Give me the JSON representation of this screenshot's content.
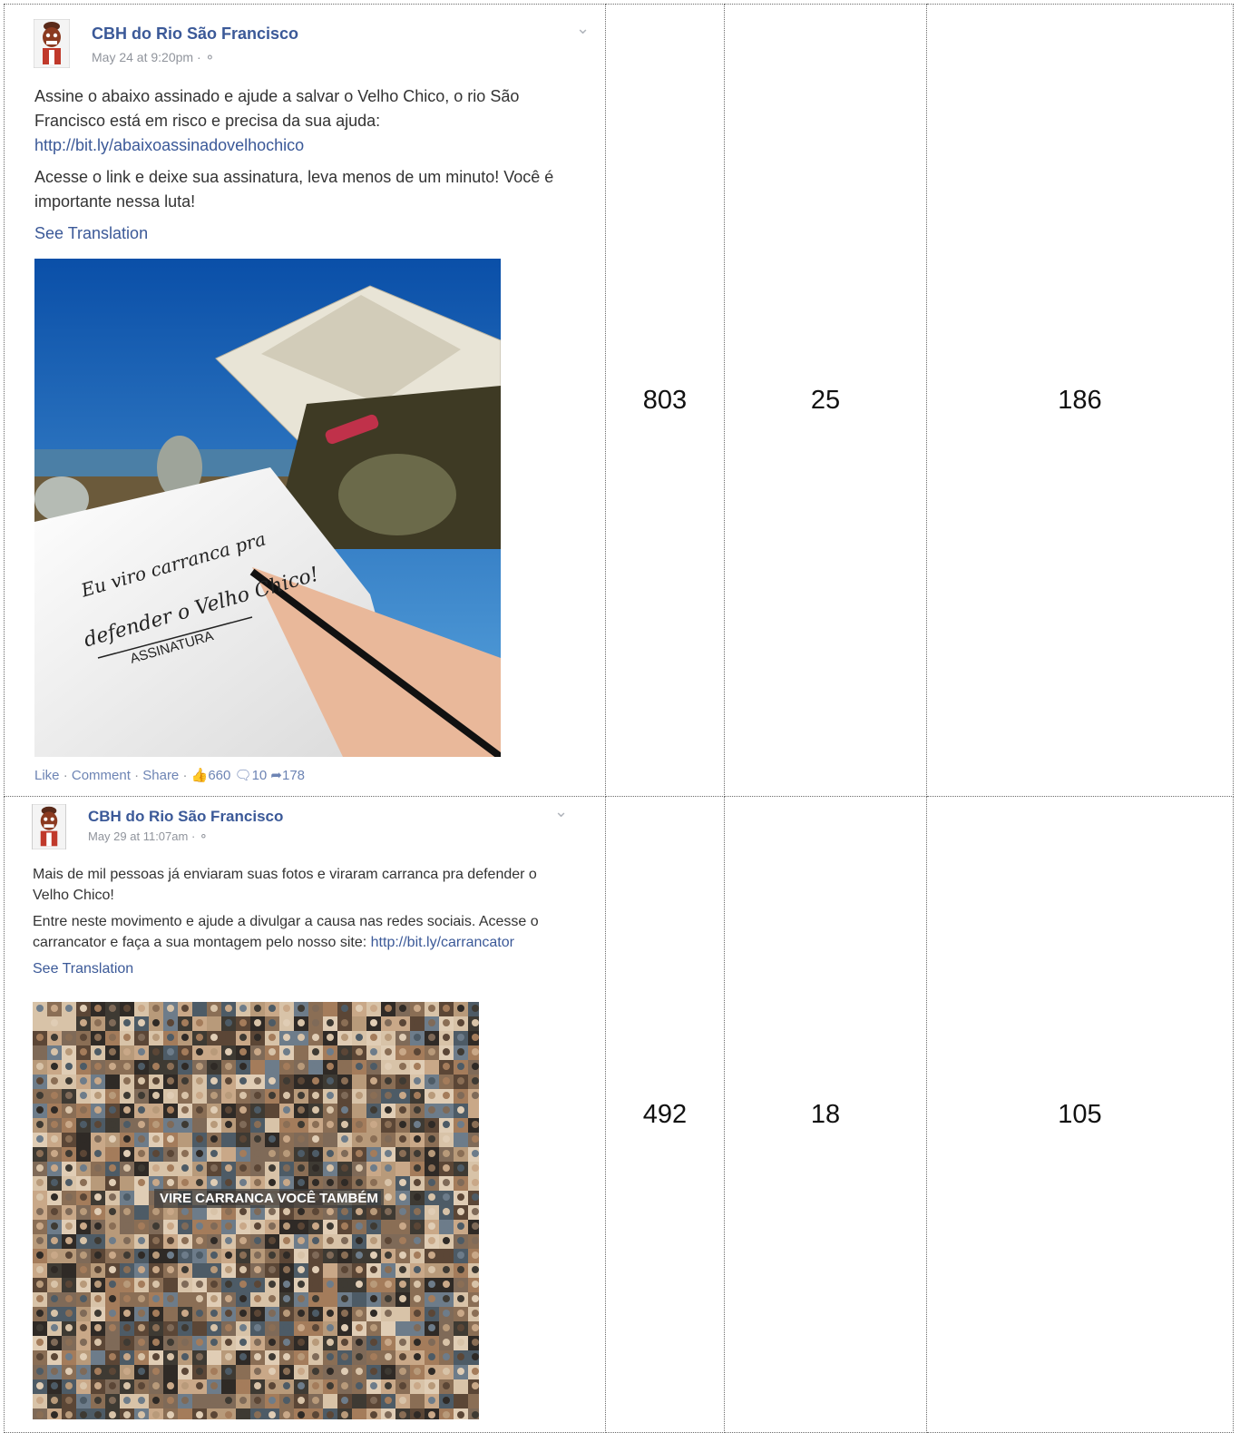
{
  "rows": [
    {
      "author": "CBH do Rio São Francisco",
      "timestamp": "May 24 at 9:20pm",
      "meta_sep": "·",
      "para1": "Assine o abaixo assinado e ajude a salvar o Velho Chico, o rio São Francisco está em risco e precisa da sua ajuda: ",
      "link": "http://bit.ly/abaixoassinadovelhochico",
      "para2": "Acesse o link e deixe sua assinatura, leva menos de um minuto! Você é importante nessa luta!",
      "see_translation": "See Translation",
      "image_signature_line1": "Eu viro carranca pra",
      "image_signature_line2": "defender o Velho Chico!",
      "image_signature_label": "ASSINATURA",
      "actions": {
        "like": "Like",
        "comment": "Comment",
        "share": "Share",
        "likes_count": "660",
        "comments_count": "10",
        "shares_count": "178"
      },
      "col2": "803",
      "col3": "25",
      "col4": "186"
    },
    {
      "author": "CBH do Rio São Francisco",
      "timestamp": "May 29 at 11:07am",
      "meta_sep": "·",
      "para1": "Mais de mil pessoas já enviaram suas fotos e viraram carranca pra defender o Velho Chico!",
      "para2": "Entre neste movimento e ajude a divulgar a causa nas redes sociais. Acesse o carrancator e faça a sua montagem pelo nosso site: ",
      "link": "http://bit.ly/carrancator",
      "see_translation": "See Translation",
      "image_banner": "VIRE CARRANCA VOCÊ TAMBÉM",
      "col2": "492",
      "col3": "18",
      "col4": "105"
    }
  ],
  "colors": {
    "link": "#3b5998",
    "meta": "#90949c"
  },
  "icons": [
    "globe-icon",
    "chevron-down-icon",
    "thumbs-up-icon",
    "comment-icon",
    "share-icon"
  ]
}
